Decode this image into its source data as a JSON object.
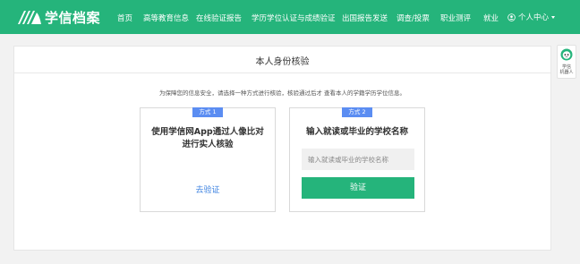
{
  "brand": {
    "name": "学信档案"
  },
  "nav": {
    "items": [
      "首页",
      "高等教育信息",
      "在线验证报告",
      "学历学位认证与成绩验证",
      "出国报告发送",
      "调查/投票",
      "职业测评",
      "就业"
    ],
    "user_menu": "个人中心"
  },
  "page": {
    "title": "本人身份核验",
    "notice": "为保障您的信息安全，请选择一种方式进行核验，核验通过后才 查看本人的学籍学历学位信息。"
  },
  "method1": {
    "badge": "方式 1",
    "heading": "使用学信网App通过人像比对进行实人核验",
    "link": "去验证"
  },
  "method2": {
    "badge": "方式 2",
    "heading": "输入就读或毕业的学校名称",
    "input_placeholder": "输入就读或毕业的学校名称",
    "input_value": "",
    "button": "验证"
  },
  "robot": {
    "label_line1": "学信",
    "label_line2": "机器人"
  },
  "colors": {
    "brand_green": "#25b47b",
    "badge_blue": "#5b8df2",
    "link_blue": "#3d82e0"
  }
}
